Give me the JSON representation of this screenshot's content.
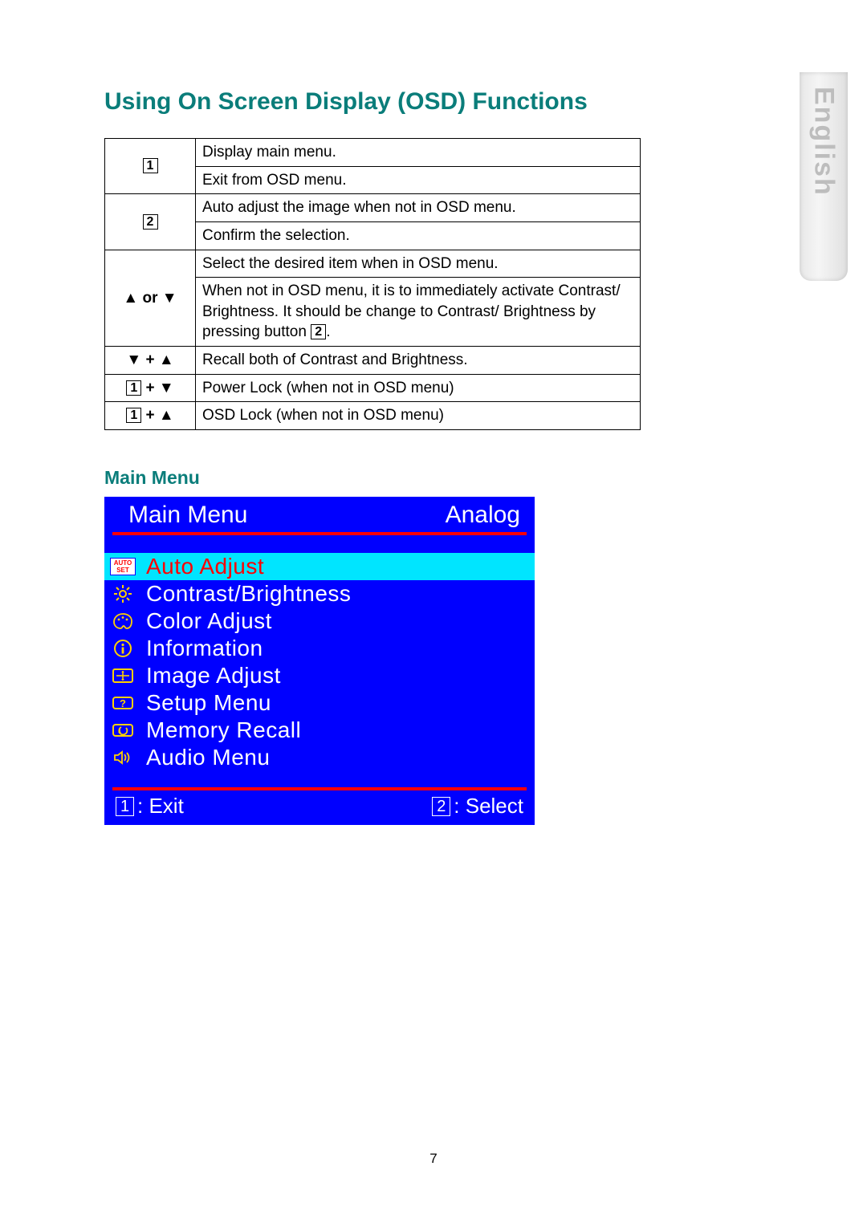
{
  "language_tab": "English",
  "page_number": "7",
  "section_title": "Using On Screen Display (OSD) Functions",
  "sub_title": "Main Menu",
  "table": {
    "rows": [
      {
        "key_html": "box1",
        "desc": "Display main menu."
      },
      {
        "key_html": "",
        "desc": "Exit from OSD menu."
      },
      {
        "key_html": "box2",
        "desc": "Auto adjust the image when not in OSD menu."
      },
      {
        "key_html": "",
        "desc": "Confirm the selection."
      },
      {
        "key_html": "up_or_down",
        "desc": "Select the desired item when in OSD menu."
      },
      {
        "key_html": "",
        "desc_html": "row6"
      },
      {
        "key_html": "down_plus_up",
        "desc": "Recall both of Contrast and Brightness."
      },
      {
        "key_html": "box1_plus_down",
        "desc": "Power Lock (when not in OSD menu)"
      },
      {
        "key_html": "box1_plus_up",
        "desc": "OSD Lock (when not in OSD menu)"
      }
    ],
    "row6_prefix": "When not in OSD menu, it is to immediately activate Contrast/ Brightness. It should be change to Contrast/ Brightness by pressing button ",
    "row6_suffix": "."
  },
  "osd": {
    "header_left": "Main Menu",
    "header_right": "Analog",
    "items": [
      {
        "label": "Auto Adjust",
        "icon": "auto-set",
        "selected": true
      },
      {
        "label": "Contrast/Brightness",
        "icon": "sun",
        "selected": false
      },
      {
        "label": "Color Adjust",
        "icon": "palette",
        "selected": false
      },
      {
        "label": "Information",
        "icon": "info",
        "selected": false
      },
      {
        "label": "Image Adjust",
        "icon": "image-adj",
        "selected": false
      },
      {
        "label": "Setup Menu",
        "icon": "setup",
        "selected": false
      },
      {
        "label": "Memory Recall",
        "icon": "recall",
        "selected": false
      },
      {
        "label": "Audio Menu",
        "icon": "audio",
        "selected": false
      }
    ],
    "footer_left": ": Exit",
    "footer_right": ": Select"
  }
}
